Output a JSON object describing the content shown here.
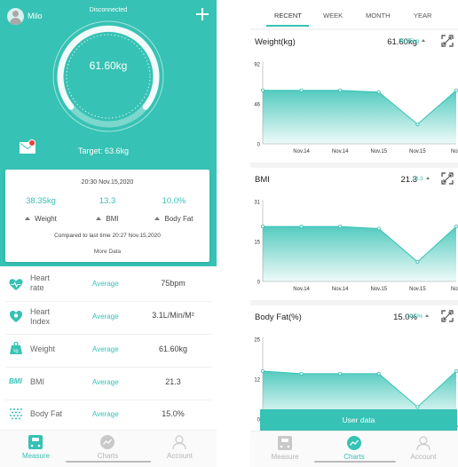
{
  "colors": {
    "accent": "#36c2b4",
    "badge": "#e9423a",
    "muted": "#b5b5b5"
  },
  "left": {
    "header": {
      "username": "Milo",
      "status": "Disconnected"
    },
    "gauge": {
      "weight": "61.60kg"
    },
    "target": "Target: 63.6kg",
    "summary": {
      "datetime": "20:30 Nov.15,2020",
      "metrics": [
        {
          "value": "38.35kg",
          "label": "Weight"
        },
        {
          "value": "13.3",
          "label": "BMI"
        },
        {
          "value": "10.0%",
          "label": "Body Fat"
        }
      ],
      "compared": "Compared to last time 20:27 Nov.15,2020",
      "more": "More Data"
    },
    "rows": [
      {
        "name1": "Heart",
        "name2": "rate",
        "status": "Average",
        "value": "75bpm",
        "icon": "heart-rate-icon"
      },
      {
        "name1": "Heart",
        "name2": "Index",
        "status": "Average",
        "value": "3.1L/Min/M²",
        "icon": "heart-index-icon"
      },
      {
        "name1": "Weight",
        "name2": "",
        "status": "Average",
        "value": "61.60kg",
        "icon": "weight-scale-icon"
      },
      {
        "name1": "BMI",
        "name2": "",
        "status": "Average",
        "value": "21.3",
        "icon": "bmi-icon",
        "icon_text": "BMI"
      },
      {
        "name1": "Body Fat",
        "name2": "",
        "status": "Average",
        "value": "15.0%",
        "icon": "body-fat-icon"
      }
    ],
    "tabs": [
      {
        "label": "Measure",
        "active": true
      },
      {
        "label": "Charts",
        "active": false
      },
      {
        "label": "Account",
        "active": false
      }
    ]
  },
  "right": {
    "periods": [
      "RECENT",
      "WEEK",
      "MONTH",
      "YEAR"
    ],
    "active_period": "RECENT",
    "panels": [
      {
        "title": "Weight(kg)",
        "value": "61.60kg",
        "sub": "38.35kg"
      },
      {
        "title": "BMI",
        "value": "21.3",
        "sub": "13.3"
      },
      {
        "title": "Body Fat(%)",
        "value": "15.0%",
        "sub": "10.0%"
      }
    ],
    "user_data_button": "User data",
    "tabs": [
      {
        "label": "Measure",
        "active": false
      },
      {
        "label": "Charts",
        "active": true
      },
      {
        "label": "Account",
        "active": false
      }
    ]
  },
  "chart_data": [
    {
      "type": "area",
      "title": "Weight(kg)",
      "ylim": [
        0,
        92
      ],
      "yticks": [
        "92",
        "46",
        "0"
      ],
      "categories": [
        "",
        "Nov.14",
        "Nov.14",
        "Nov.15",
        "Nov.15",
        "Nov."
      ],
      "values": [
        61.6,
        61.6,
        61.6,
        59.5,
        22.5,
        61.6
      ]
    },
    {
      "type": "area",
      "title": "BMI",
      "ylim": [
        0,
        31
      ],
      "yticks": [
        "31",
        "15",
        "0"
      ],
      "categories": [
        "",
        "Nov.14",
        "Nov.14",
        "Nov.15",
        "Nov.15",
        "Nov."
      ],
      "values": [
        21.3,
        21.3,
        21.3,
        20.5,
        7.6,
        21.3
      ]
    },
    {
      "type": "area",
      "title": "Body Fat(%)",
      "ylim": [
        0,
        25
      ],
      "yticks": [
        "25",
        "12",
        "0"
      ],
      "categories": [
        "",
        "Nov.14",
        "Nov.14",
        "Nov.15",
        "Nov.15",
        "Nov."
      ],
      "values": [
        15.0,
        14.2,
        14.2,
        14.2,
        3.8,
        15.0
      ]
    }
  ]
}
